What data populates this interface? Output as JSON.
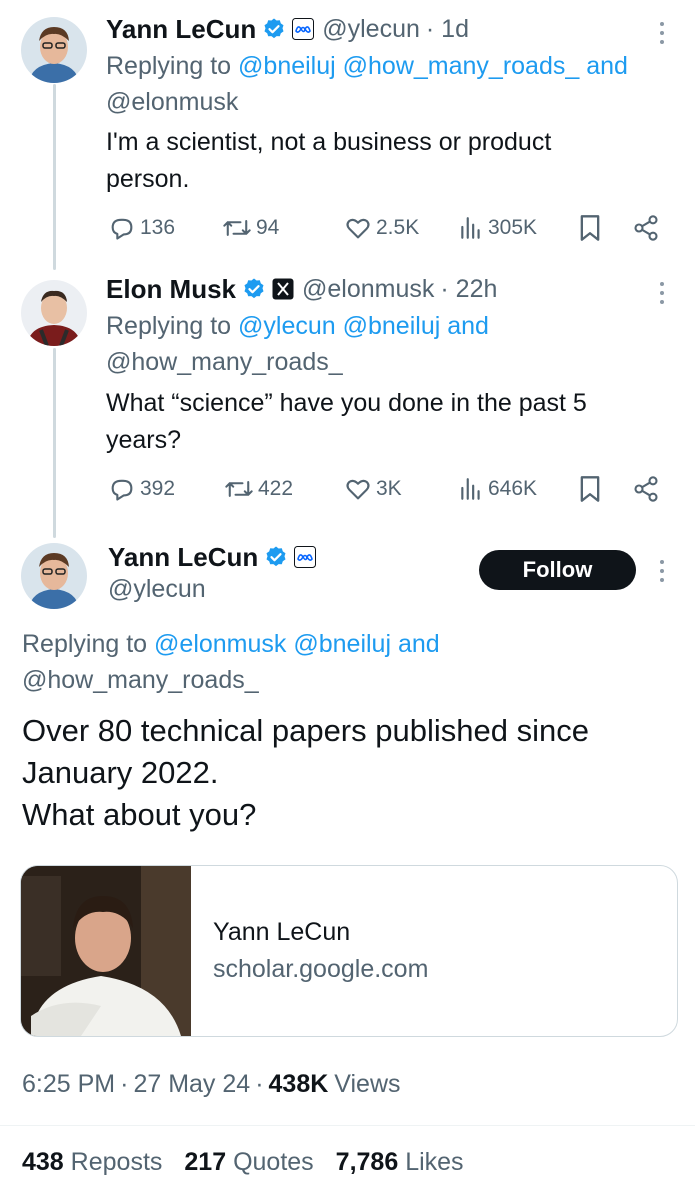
{
  "tweet1": {
    "name": "Yann LeCun",
    "handle": "@ylecun",
    "time": "· 1d",
    "replying_prefix": "Replying to",
    "replying_line1": "@bneiluj @how_many_roads_ and",
    "replying_line2": "@elonmusk",
    "text_line1": "I'm a scientist, not a business or product",
    "text_line2": "person.",
    "replies": "136",
    "reposts": "94",
    "likes": "2.5K",
    "views": "305K"
  },
  "tweet2": {
    "name": "Elon Musk",
    "handle": "@elonmusk",
    "time": "· 22h",
    "replying_prefix": "Replying to",
    "replying_line1": "@ylecun @bneiluj and",
    "replying_line2": "@how_many_roads_",
    "text_line1": "What “science” have you done in the past 5",
    "text_line2": "years?",
    "replies": "392",
    "reposts": "422",
    "likes": "3K",
    "views": "646K"
  },
  "main": {
    "name": "Yann LeCun",
    "handle": "@ylecun",
    "follow_label": "Follow",
    "replying_prefix": "Replying to",
    "replying_line1": "@elonmusk @bneiluj and",
    "replying_line2": "@how_many_roads_",
    "text_line1": "Over 80 technical papers published since",
    "text_line2": "January 2022.",
    "text_line3": "What about you?",
    "card_title": "Yann LeCun",
    "card_domain": "scholar.google.com",
    "time": "6:25 PM",
    "date": "27 May 24",
    "views_count": "438K",
    "views_label": "Views",
    "reposts_count": "438",
    "reposts_label": "Reposts",
    "quotes_count": "217",
    "quotes_label": "Quotes",
    "likes_count": "7,786",
    "likes_label": "Likes"
  },
  "colors": {
    "link": "#1d9bf0",
    "muted": "#536471",
    "text": "#0f1419",
    "verified": "#1d9bf0"
  },
  "icons": [
    "reply-icon",
    "repost-icon",
    "like-icon",
    "views-icon",
    "bookmark-icon",
    "share-icon",
    "verified-icon",
    "meta-affiliate-icon",
    "x-affiliate-icon",
    "more-icon"
  ]
}
